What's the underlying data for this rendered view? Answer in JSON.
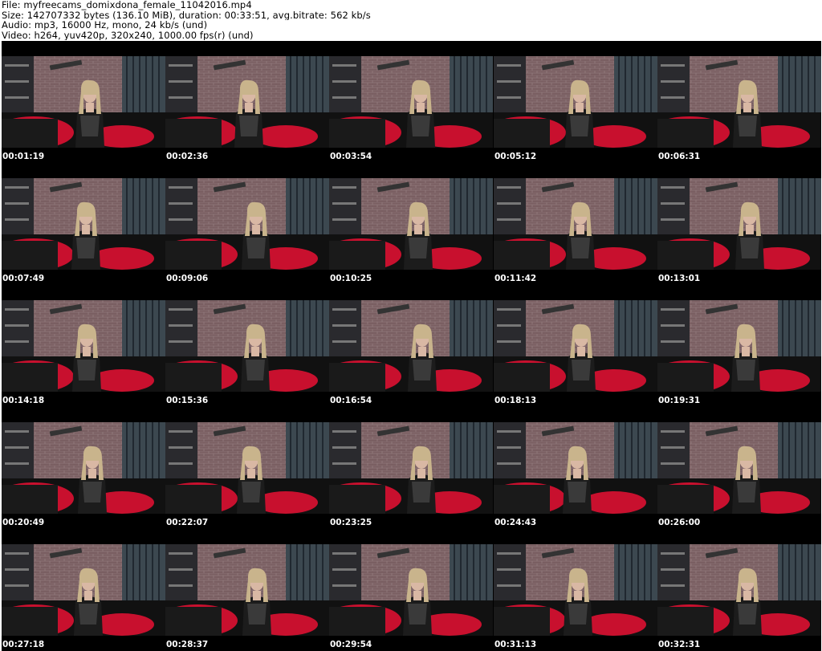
{
  "header": {
    "file_line": "File: myfreecams_domixdona_female_11042016.mp4",
    "size_line": "Size: 142707332 bytes (136.10 MiB), duration: 00:33:51, avg.bitrate: 562 kb/s",
    "audio_line": "Audio: mp3, 16000 Hz, mono, 24 kb/s (und)",
    "video_line": "Video: h264, yuv420p, 320x240, 1000.00 fps(r) (und)"
  },
  "thumbnails": [
    {
      "time": "00:01:19"
    },
    {
      "time": "00:02:36"
    },
    {
      "time": "00:03:54"
    },
    {
      "time": "00:05:12"
    },
    {
      "time": "00:06:31"
    },
    {
      "time": "00:07:49"
    },
    {
      "time": "00:09:06"
    },
    {
      "time": "00:10:25"
    },
    {
      "time": "00:11:42"
    },
    {
      "time": "00:13:01"
    },
    {
      "time": "00:14:18"
    },
    {
      "time": "00:15:36"
    },
    {
      "time": "00:16:54"
    },
    {
      "time": "00:18:13"
    },
    {
      "time": "00:19:31"
    },
    {
      "time": "00:20:49"
    },
    {
      "time": "00:22:07"
    },
    {
      "time": "00:23:25"
    },
    {
      "time": "00:24:43"
    },
    {
      "time": "00:26:00"
    },
    {
      "time": "00:27:18"
    },
    {
      "time": "00:28:37"
    },
    {
      "time": "00:29:54"
    },
    {
      "time": "00:31:13"
    },
    {
      "time": "00:32:31"
    }
  ],
  "colors": {
    "sheet_background": "#000000",
    "timecode_text": "#ffffff",
    "header_text": "#000000",
    "brick_wall": "#7a5f62",
    "cage_bars": "#3c4850",
    "sofa_red": "#c8102e",
    "sofa_black": "#111111"
  }
}
